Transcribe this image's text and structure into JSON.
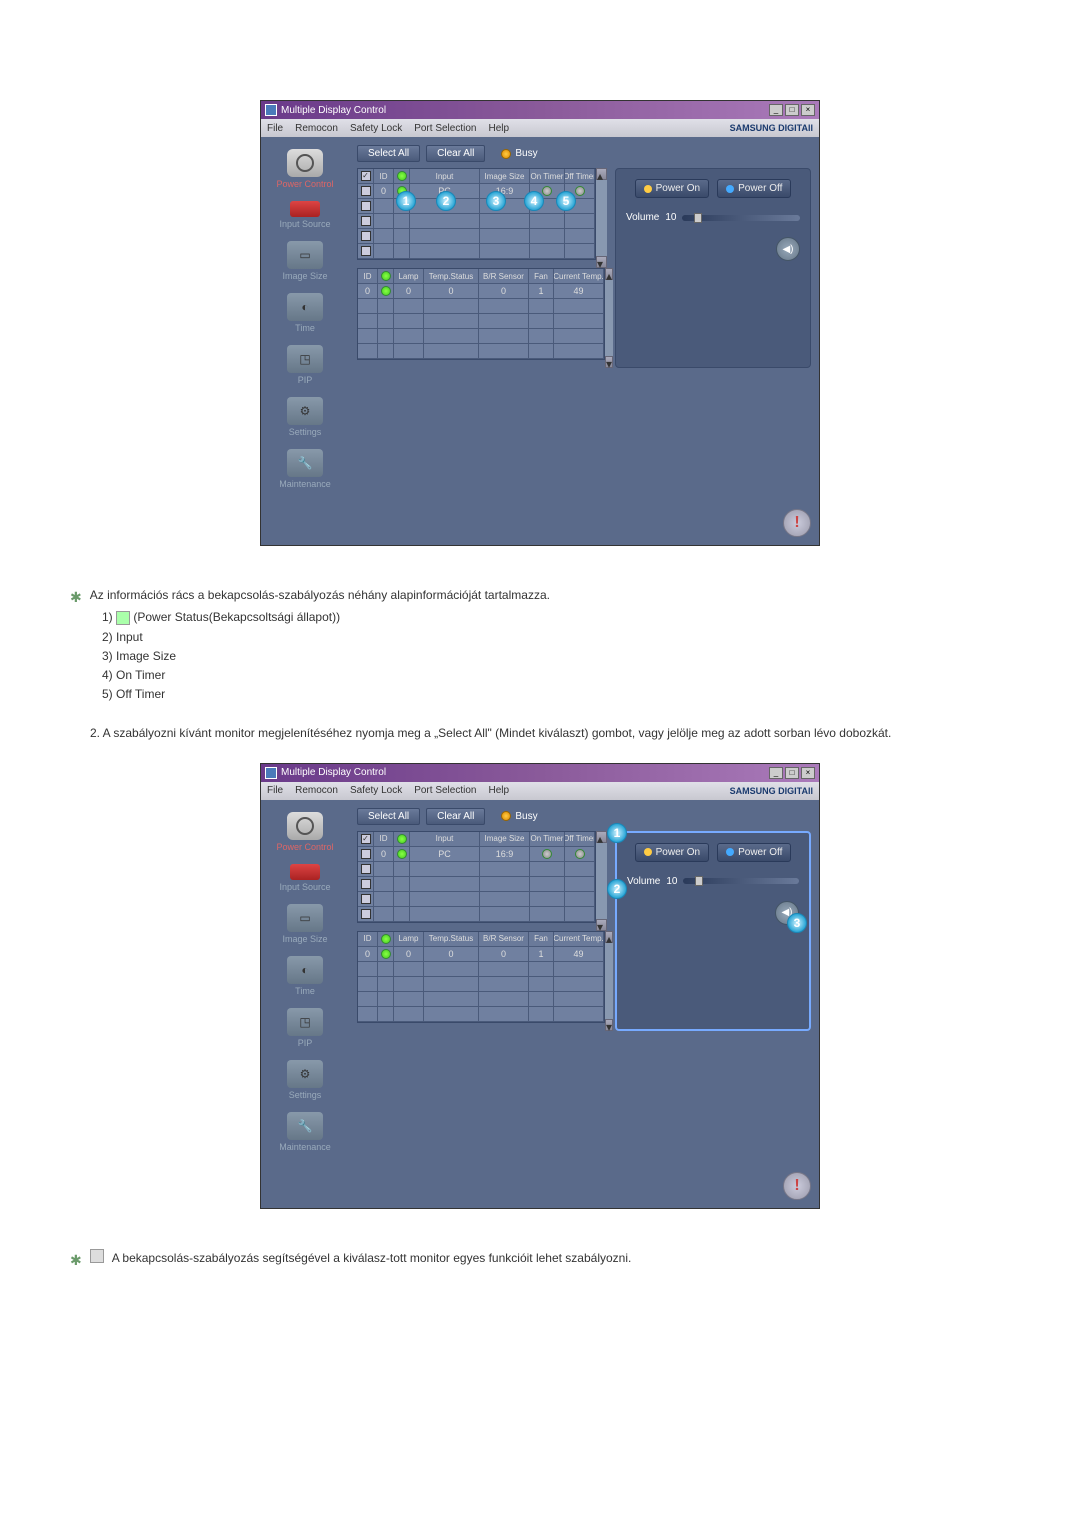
{
  "app": {
    "title": "Multiple Display Control",
    "menus": [
      "File",
      "Remocon",
      "Safety Lock",
      "Port Selection",
      "Help"
    ],
    "brand": "SAMSUNG DIGITAll"
  },
  "sidebar": [
    {
      "label": "Power Control",
      "active": true
    },
    {
      "label": "Input Source"
    },
    {
      "label": "Image Size"
    },
    {
      "label": "Time"
    },
    {
      "label": "PIP"
    },
    {
      "label": "Settings"
    },
    {
      "label": "Maintenance"
    }
  ],
  "toolbar": {
    "select_all": "Select All",
    "clear_all": "Clear All",
    "busy": "Busy"
  },
  "grid1": {
    "headers": [
      "",
      "ID",
      "",
      "Input",
      "Image Size",
      "On Timer",
      "Off Timer"
    ],
    "row": {
      "checked": true,
      "id": "0",
      "status": "green",
      "input": "PC",
      "image_size": "16:9",
      "on_timer": "○",
      "off_timer": "○"
    }
  },
  "grid2": {
    "headers": [
      "ID",
      "",
      "Lamp",
      "Temp.Status",
      "B/R Sensor",
      "Fan",
      "Current Temp."
    ],
    "row": {
      "id": "0",
      "status": "green",
      "lamp": "0",
      "temp_status": "0",
      "br_sensor": "0",
      "fan": "1",
      "current_temp": "49"
    }
  },
  "panel": {
    "power_on": "Power On",
    "power_off": "Power Off",
    "volume_label": "Volume",
    "volume": "10"
  },
  "doc": {
    "p1": "Az információs rács a bekapcsolás-szabályozás néhány alapinformációját tartalmazza.",
    "li1a": "1) ",
    "li1b": " (Power Status(Bekapcsoltsági állapot))",
    "li2": "2) Input",
    "li3": "3) Image Size",
    "li4": "4) On Timer",
    "li5": "5) Off Timer",
    "p2": "2.  A szabályozni kívánt monitor megjelenítéséhez nyomja meg a „Select All\" (Mindet kiválaszt) gombot, vagy jelölje meg az adott sorban lévo dobozkát.",
    "p3": "A bekapcsolás-szabályozás segítségével a kiválasz-tott monitor egyes funkcióit lehet szabályozni."
  },
  "markers1": [
    "1",
    "2",
    "3",
    "4",
    "5"
  ],
  "markers2": [
    "1",
    "2",
    "3"
  ]
}
